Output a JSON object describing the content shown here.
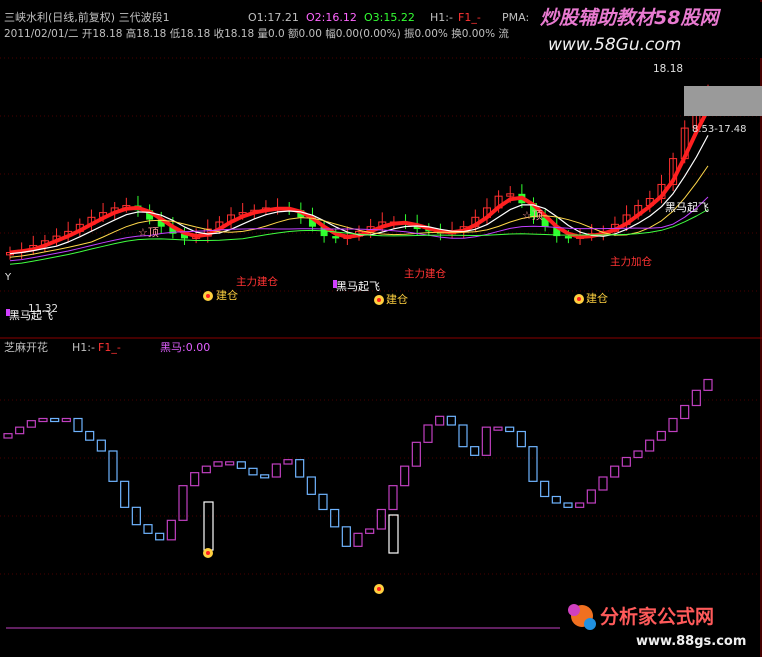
{
  "top_panel": {
    "title_line": "三峡水利(日线,前复权) 三代波段1",
    "o1": "O1:17.21",
    "o2": "O2:16.12",
    "o3": "O3:15.22",
    "h1": "H1:-",
    "f1": "F1_-",
    "pma": "PMA:1",
    "info_line": "2011/02/01/二 开18.18 高18.18 低18.18 收18.18 量0.0 额0.00 幅0.00(0.00%) 振0.00% 换0.00% 流"
  },
  "watermark_top": {
    "title": "炒股辅助教材58股网",
    "url": "www.58Gu.com"
  },
  "watermark_bottom": {
    "title": "分析家公式网",
    "url": "www.88gs.com"
  },
  "bottom_panel": {
    "title": "芝麻开花",
    "h1": "H1:-",
    "f1": "F1_-",
    "heima": "黑马:0.00"
  },
  "annotations": {
    "price_high": "18.18",
    "price_range": "8.53-17.48",
    "price_low": "11.32",
    "top_label": "☆顶",
    "heima_label": "黑马起飞",
    "build_label": "建仓",
    "main_build": "主力建仓",
    "main_add": "主力加仓",
    "y_mark": "Y"
  },
  "chart_data": [
    {
      "type": "candlestick",
      "title": "三峡水利(日线,前复权) 三代波段1",
      "ylim": [
        8,
        19.5
      ],
      "closes": [
        11.3,
        11.4,
        11.6,
        11.8,
        12.0,
        12.2,
        12.5,
        12.8,
        13.0,
        13.2,
        13.3,
        13.1,
        12.7,
        12.4,
        12.1,
        11.9,
        12.0,
        12.3,
        12.6,
        12.9,
        13.0,
        13.1,
        13.2,
        13.2,
        13.1,
        12.8,
        12.4,
        12.0,
        11.9,
        12.0,
        12.2,
        12.4,
        12.6,
        12.6,
        12.5,
        12.3,
        12.2,
        12.1,
        12.2,
        12.4,
        12.8,
        13.2,
        13.7,
        13.8,
        13.4,
        12.8,
        12.4,
        12.0,
        11.9,
        12.0,
        12.1,
        12.2,
        12.5,
        12.9,
        13.3,
        13.6,
        14.2,
        15.3,
        16.6,
        17.4,
        18.2
      ],
      "labels": [
        "11.32",
        "18.18",
        "8.53-17.48"
      ]
    },
    {
      "type": "bar",
      "title": "芝麻开花",
      "series": [
        {
          "name": "黑马",
          "values": [
            0.0
          ]
        }
      ]
    }
  ]
}
